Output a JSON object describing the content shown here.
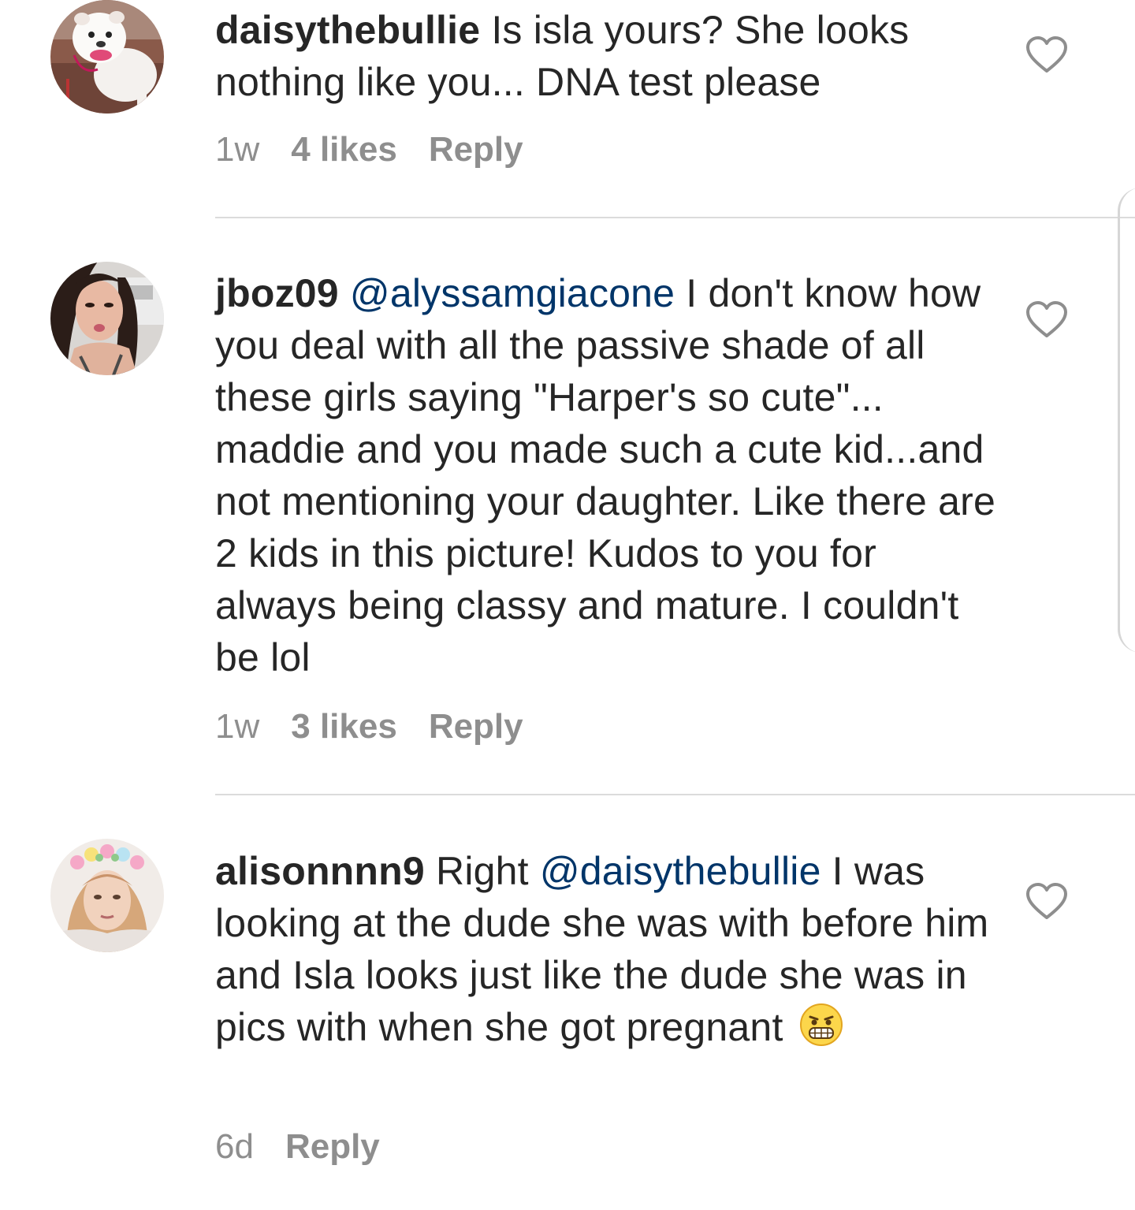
{
  "comments": [
    {
      "username": "daisythebullie",
      "text": " Is isla yours? She looks nothing like you... DNA test please",
      "time": "1w",
      "likes": "4 likes",
      "reply": "Reply",
      "avatar_icon": "bulldog-avatar"
    },
    {
      "username": "jboz09",
      "mention": "@alyssamgiacone",
      "text": " I don't know how you deal with all the passive shade of all these girls saying \"Harper's so cute\"... maddie and you made such a cute kid...and not mentioning your daughter.  Like there are 2 kids in this picture! Kudos to you for always being classy and mature. I couldn't be lol",
      "time": "1w",
      "likes": "3 likes",
      "reply": "Reply",
      "avatar_icon": "woman-avatar"
    },
    {
      "username": "alisonnnn9",
      "text_before": " Right ",
      "mention": "@daisythebullie",
      "text": " I was looking at the dude she was with before him and Isla looks just like the dude she was in pics with when she got pregnant",
      "emoji": "grimacing-face-emoji",
      "time": "6d",
      "reply": "Reply",
      "avatar_icon": "flower-crown-avatar"
    }
  ],
  "colors": {
    "text": "#262626",
    "meta": "#8e8e8e",
    "mention": "#003569",
    "divider": "#dbdbdb"
  }
}
